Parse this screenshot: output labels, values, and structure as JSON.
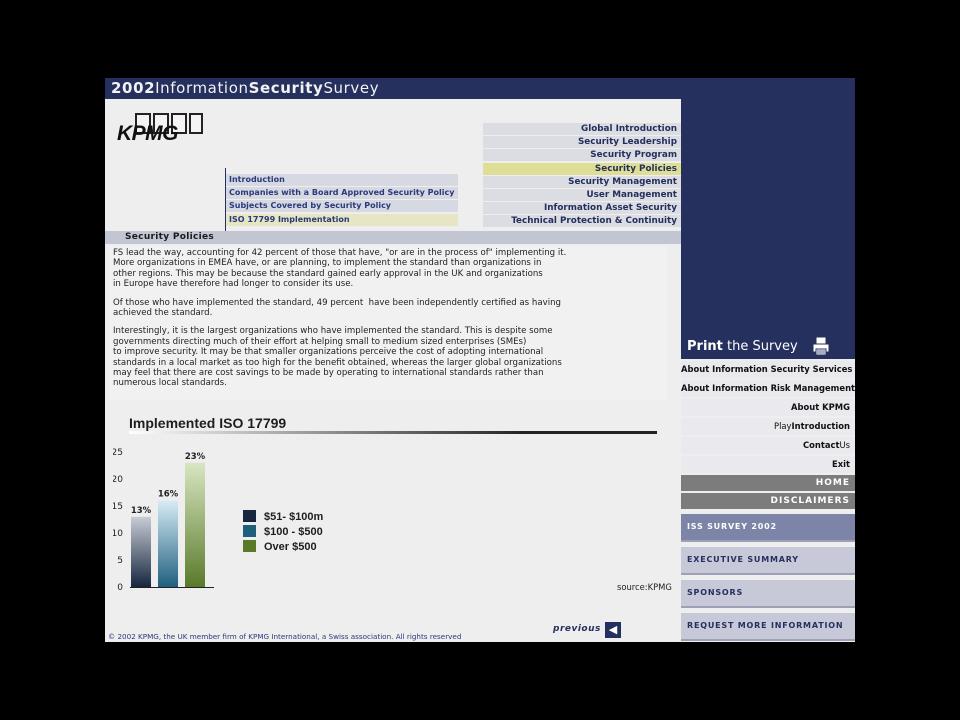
{
  "header": {
    "title_part1": "2002",
    "title_part2": "Information",
    "title_part3": "Security",
    "title_part4": "Survey"
  },
  "logo": {
    "text": "KPMG"
  },
  "topics": [
    {
      "label": "Global Introduction",
      "active": false
    },
    {
      "label": "Security Leadership",
      "active": false
    },
    {
      "label": "Security Program",
      "active": false
    },
    {
      "label": "Security Policies",
      "active": true
    },
    {
      "label": "Security Management",
      "active": false
    },
    {
      "label": "User Management",
      "active": false
    },
    {
      "label": "Information Asset Security",
      "active": false
    },
    {
      "label": "Technical Protection & Continuity",
      "active": false
    }
  ],
  "subnav": [
    {
      "label": "Introduction",
      "active": false
    },
    {
      "label": "Companies with a Board Approved Security Policy",
      "active": false
    },
    {
      "label": "Subjects Covered by Security Policy",
      "active": false
    },
    {
      "label": "ISO 17799 Implementation",
      "active": true
    }
  ],
  "section": {
    "label": "Security Policies"
  },
  "body": {
    "p1": "FS lead the way, accounting for 42 percent of those that have, \"or are in the process of\" implementing it.\nMore organizations in EMEA have, or are planning, to implement the standard than organizations in\nother regions. This may be because the standard gained early approval in the UK and organizations\nin Europe have therefore had longer to consider its use.",
    "p2": "Of those who have implemented the standard, 49 percent  have been independently certified as having\nachieved the standard.",
    "p3": "Interestingly, it is the largest organizations who have implemented the standard. This is despite some\ngovernments directing much of their effort at helping small to medium sized enterprises (SMEs)\nto improve security. It may be that smaller organizations perceive the cost of adopting international\nstandards in a local market as too high for the benefit obtained, whereas the larger global organizations\nmay feel that there are cost savings to be made by operating to international standards rather than\nnumerous local standards."
  },
  "chart_data": {
    "type": "bar",
    "title": "Implemented ISO 17799",
    "categories": [
      "$51- $100m",
      "$100 - $500",
      "Over $500"
    ],
    "values": [
      13,
      16,
      23
    ],
    "data_labels": [
      "13%",
      "16%",
      "23%"
    ],
    "ylim": [
      0,
      25
    ],
    "yticks": [
      0,
      5,
      10,
      15,
      20,
      25
    ],
    "legend": [
      "$51- $100m",
      "$100 - $500",
      "Over $500"
    ],
    "legend_position": "right",
    "colors": [
      "#16263f",
      "#1f5f7e",
      "#5a7a2a"
    ],
    "source": "source:KPMG"
  },
  "footer": {
    "copyright": "© 2002 KPMG, the UK member firm of KPMG International, a Swiss association. All rights reserved",
    "previous": "previous"
  },
  "right": {
    "print_bold": "Print",
    "print_rest": " the Survey",
    "links": [
      {
        "text": "About Information Security Services"
      },
      {
        "text": "About Information Risk Management"
      },
      {
        "text": "About KPMG"
      },
      {
        "light": "Play",
        "bold": "Introduction"
      },
      {
        "bold": "Contact",
        "light": "Us"
      },
      {
        "text": "Exit"
      }
    ],
    "home": "HOME",
    "disclaimers": "DISCLAIMERS",
    "mainnav": [
      "ISS SURVEY 2002",
      "EXECUTIVE SUMMARY",
      "SPONSORS",
      "REQUEST MORE INFORMATION"
    ]
  }
}
